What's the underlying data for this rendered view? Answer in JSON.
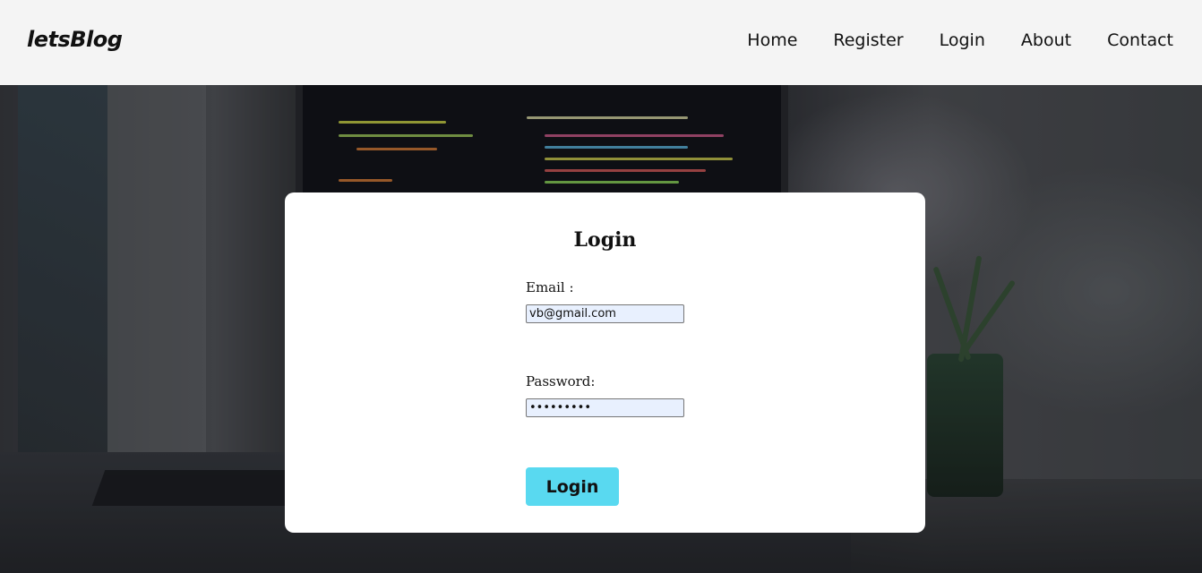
{
  "brand": "letsBlog",
  "nav": {
    "items": [
      "Home",
      "Register",
      "Login",
      "About",
      "Contact"
    ]
  },
  "login_form": {
    "title": "Login",
    "email_label": "Email :",
    "email_value": "vb@gmail.com",
    "password_label": "Password:",
    "password_value": "•••••••••",
    "submit_label": "Login"
  },
  "colors": {
    "navbar_bg": "#f4f4f4",
    "button_bg": "#59d9f0",
    "input_bg": "#e8f0fe"
  }
}
